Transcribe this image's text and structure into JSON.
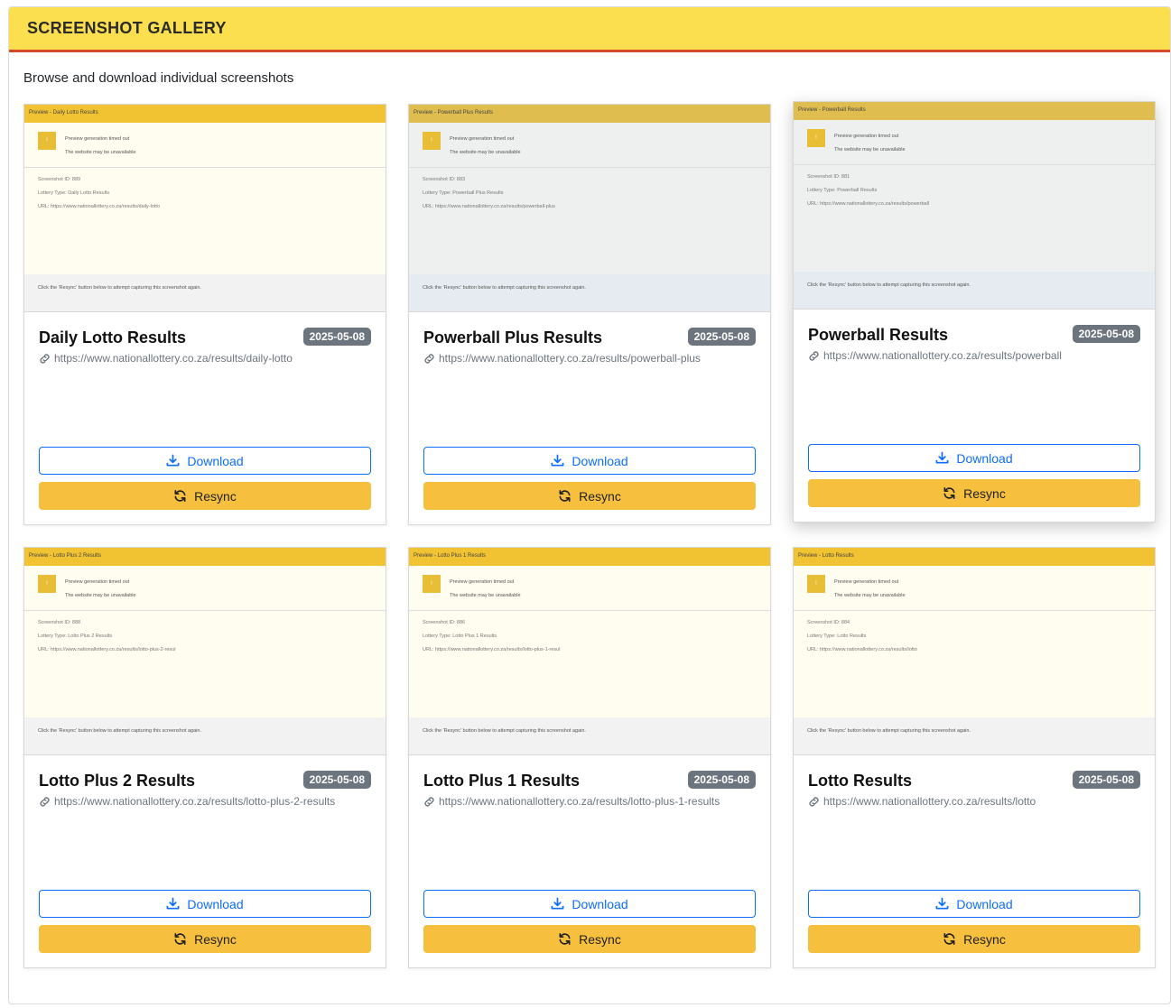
{
  "panel": {
    "title": "SCREENSHOT GALLERY",
    "subtitle": "Browse and download individual screenshots"
  },
  "buttons": {
    "download": "Download",
    "resync": "Resync"
  },
  "icons": {
    "link": "link-icon",
    "download": "download-icon",
    "resync": "sync-icon"
  },
  "colors": {
    "header_bg": "#fbdf4e",
    "header_border": "#d44a2b",
    "download_border": "#0d6efd",
    "resync_bg": "#f6c03e",
    "badge_bg": "#6c757d"
  },
  "cards": [
    {
      "title": "Daily Lotto Results",
      "date": "2025-05-08",
      "url": "https://www.nationallottery.co.za/results/daily-lotto",
      "preview": {
        "header": "Preview - Daily Lotto Results",
        "msg1": "Preview generation timed out",
        "msg2": "The website may be unavailable",
        "id": "Screenshot ID: 889",
        "type": "Lottery Type: Daily Lotto Results",
        "url": "URL: https://www.nationallottery.co.za/results/daily-lotto",
        "footer": "Click the 'Resync' button below to attempt capturing this screenshot again."
      }
    },
    {
      "title": "Powerball Plus Results",
      "date": "2025-05-08",
      "url": "https://www.nationallottery.co.za/results/powerball-plus",
      "preview": {
        "header": "Preview - Powerball Plus Results",
        "msg1": "Preview generation timed out",
        "msg2": "The website may be unavailable",
        "id": "Screenshot ID: 883",
        "type": "Lottery Type: Powerball Plus Results",
        "url": "URL: https://www.nationallottery.co.za/results/powerball-plus",
        "footer": "Click the 'Resync' button below to attempt capturing this screenshot again."
      }
    },
    {
      "title": "Powerball Results",
      "date": "2025-05-08",
      "url": "https://www.nationallottery.co.za/results/powerball",
      "preview": {
        "header": "Preview - Powerball Results",
        "msg1": "Preview generation timed out",
        "msg2": "The website may be unavailable",
        "id": "Screenshot ID: 881",
        "type": "Lottery Type: Powerball Results",
        "url": "URL: https://www.nationallottery.co.za/results/powerball",
        "footer": "Click the 'Resync' button below to attempt capturing this screenshot again."
      }
    },
    {
      "title": "Lotto Plus 2 Results",
      "date": "2025-05-08",
      "url": "https://www.nationallottery.co.za/results/lotto-plus-2-results",
      "preview": {
        "header": "Preview - Lotto Plus 2 Results",
        "msg1": "Preview generation timed out",
        "msg2": "The website may be unavailable",
        "id": "Screenshot ID: 888",
        "type": "Lottery Type: Lotto Plus 2 Results",
        "url": "URL: https://www.nationallottery.co.za/results/lotto-plus-2-resul",
        "footer": "Click the 'Resync' button below to attempt capturing this screenshot again."
      }
    },
    {
      "title": "Lotto Plus 1 Results",
      "date": "2025-05-08",
      "url": "https://www.nationallottery.co.za/results/lotto-plus-1-results",
      "preview": {
        "header": "Preview - Lotto Plus 1 Results",
        "msg1": "Preview generation timed out",
        "msg2": "The website may be unavailable",
        "id": "Screenshot ID: 886",
        "type": "Lottery Type: Lotto Plus 1 Results",
        "url": "URL: https://www.nationallottery.co.za/results/lotto-plus-1-resul",
        "footer": "Click the 'Resync' button below to attempt capturing this screenshot again."
      }
    },
    {
      "title": "Lotto Results",
      "date": "2025-05-08",
      "url": "https://www.nationallottery.co.za/results/lotto",
      "preview": {
        "header": "Preview - Lotto Results",
        "msg1": "Preview generation timed out",
        "msg2": "The website may be unavailable",
        "id": "Screenshot ID: 884",
        "type": "Lottery Type: Lotto Results",
        "url": "URL: https://www.nationallottery.co.za/results/lotto",
        "footer": "Click the 'Resync' button below to attempt capturing this screenshot again."
      }
    }
  ]
}
